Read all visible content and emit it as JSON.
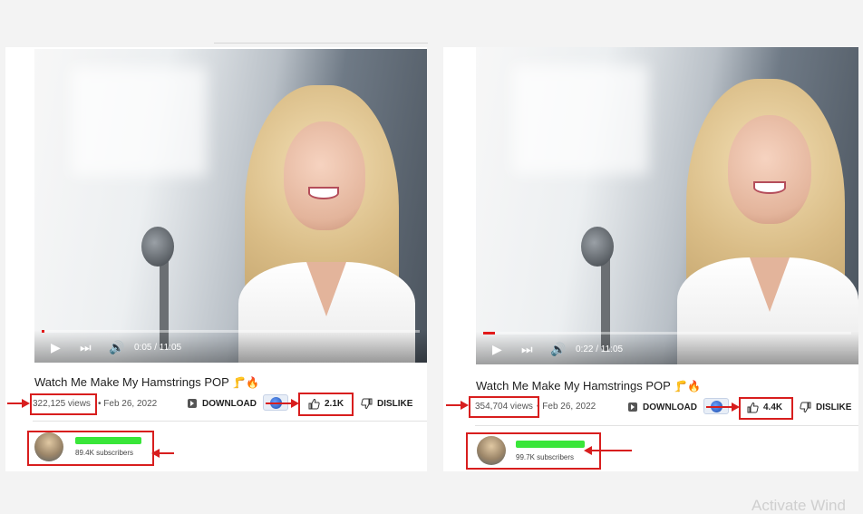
{
  "left": {
    "video": {
      "time": "0:05 / 11:05",
      "progress": 0.008
    },
    "title": "Watch Me Make My Hamstrings POP",
    "title_emojis": "🦵🔥",
    "views": "322,125 views",
    "date": "• Feb 26, 2022",
    "download_label": "DOWNLOAD",
    "likes": "2.1K",
    "dislike_label": "DISLIKE",
    "subscribers": "89.4K subscribers"
  },
  "right": {
    "video": {
      "time": "0:22 / 11:05",
      "progress": 0.033
    },
    "title": "Watch Me Make My Hamstrings POP",
    "title_emojis": "🦵🔥",
    "views": "354,704 views",
    "date": "• Feb 26, 2022",
    "download_label": "DOWNLOAD",
    "likes": "4.4K",
    "dislike_label": "DISLIKE",
    "subscribers": "99.7K subscribers"
  },
  "watermark": "Activate Wind",
  "colors": {
    "highlight": "#d81e1e",
    "redaction": "#39e639",
    "progress": "#e21a1a"
  },
  "icons": [
    "play-icon",
    "next-icon",
    "volume-icon",
    "download-icon",
    "thumbs-up-icon",
    "thumbs-down-icon",
    "clip-icon"
  ]
}
